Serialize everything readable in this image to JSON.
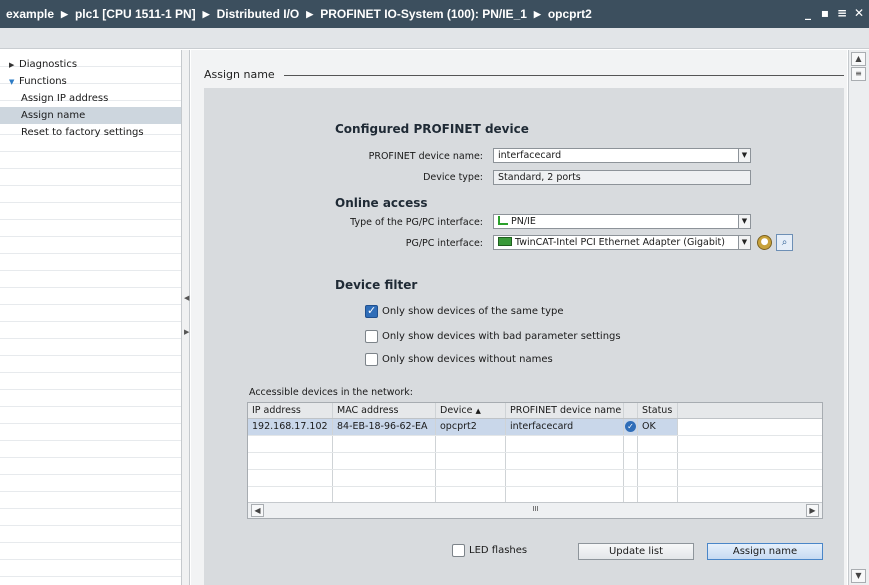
{
  "breadcrumb": [
    "example",
    "plc1 [CPU 1511-1 PN]",
    "Distributed I/O",
    "PROFINET IO-System (100): PN/IE_1",
    "opcprt2"
  ],
  "window_controls": [
    "minimize",
    "restore",
    "tile",
    "close"
  ],
  "nav": {
    "items": [
      {
        "label": "Diagnostics",
        "level": 1,
        "expanded": false
      },
      {
        "label": "Functions",
        "level": 1,
        "expanded": true
      },
      {
        "label": "Assign IP address",
        "level": 2
      },
      {
        "label": "Assign name",
        "level": 2,
        "selected": true
      },
      {
        "label": "Reset to factory settings",
        "level": 2
      }
    ]
  },
  "section": {
    "title": "Assign name"
  },
  "configured": {
    "heading": "Configured PROFINET device",
    "device_name_label": "PROFINET device name:",
    "device_name_value": "interfacecard",
    "device_type_label": "Device type:",
    "device_type_value": "Standard, 2 ports"
  },
  "online": {
    "heading": "Online access",
    "iface_type_label": "Type of the PG/PC interface:",
    "iface_type_value": "PN/IE",
    "iface_label": "PG/PC interface:",
    "iface_value": "TwinCAT-Intel PCI Ethernet Adapter (Gigabit)"
  },
  "filter": {
    "heading": "Device filter",
    "options": [
      {
        "label": "Only show devices of the same type",
        "checked": true
      },
      {
        "label": "Only show devices with bad parameter settings",
        "checked": false
      },
      {
        "label": "Only show devices without names",
        "checked": false
      }
    ]
  },
  "devices": {
    "caption": "Accessible devices in the network:",
    "columns": [
      "IP address",
      "MAC address",
      "Device",
      "PROFINET device name",
      "",
      "Status"
    ],
    "sort_indicator": "▲",
    "rows": [
      {
        "ip": "192.168.17.102",
        "mac": "84-EB-18-96-62-EA",
        "device": "opcprt2",
        "pn_name": "interfacecard",
        "status": "OK"
      }
    ],
    "hscroll_mid": "III"
  },
  "footer": {
    "led_label": "LED flashes",
    "led_checked": false,
    "update_button": "Update list",
    "assign_button": "Assign name"
  },
  "colors": {
    "titlebar": "#3c4f5e",
    "panel": "#d8dbde",
    "selection": "#c9d7ea",
    "accent": "#2f6db8"
  }
}
